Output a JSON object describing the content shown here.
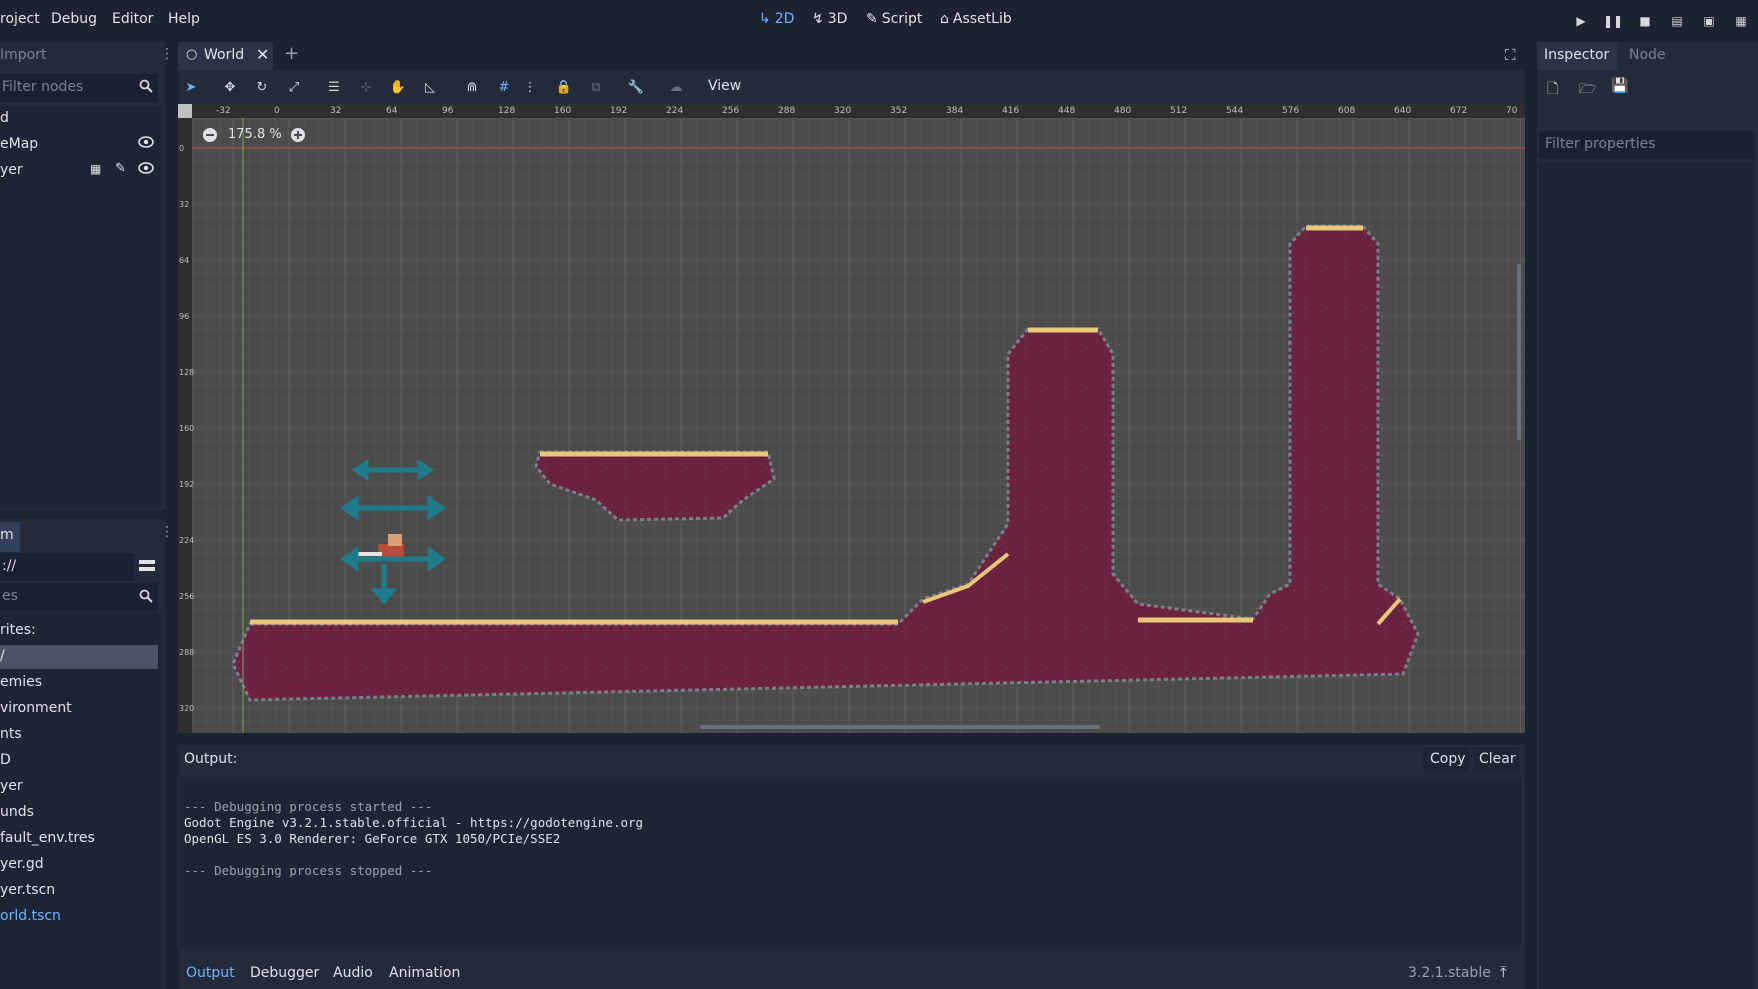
{
  "menu": {
    "project": "roject",
    "debug": "Debug",
    "editor": "Editor",
    "help": "Help"
  },
  "modes": {
    "m2d": "2D",
    "m3d": "3D",
    "script": "Script",
    "assetlib": "AssetLib"
  },
  "colors": {
    "accent": "#6fb3ff",
    "bg": "#1d2230",
    "panel": "#232a3a",
    "viewport": "#4b4b4b",
    "terrain": "#6b2340",
    "terrain_top": "#e8c67a"
  },
  "left_dock": {
    "import_tab": "Import",
    "filter_nodes_placeholder": "Filter nodes",
    "tree": [
      "d",
      "eMap",
      "yer"
    ],
    "fs_tab": "m",
    "path": "://",
    "search_placeholder": "es",
    "fs_items": [
      "rites:",
      "/",
      "emies",
      "vironment",
      "nts",
      "D",
      "yer",
      "unds",
      "fault_env.tres",
      "yer.gd",
      "yer.tscn",
      "orld.tscn"
    ]
  },
  "scene_tab": {
    "name": "World"
  },
  "toolbar": {
    "view_label": "View"
  },
  "viewport": {
    "zoom": "175.8 %",
    "ruler_x": [
      "-32",
      "0",
      "32",
      "64",
      "96",
      "128",
      "160",
      "192",
      "224",
      "256",
      "288",
      "320",
      "352",
      "384",
      "416",
      "448",
      "480",
      "512",
      "544",
      "576",
      "608",
      "640",
      "672",
      "70"
    ],
    "ruler_y": [
      "0",
      "32",
      "64",
      "96",
      "128",
      "160",
      "192",
      "224",
      "256",
      "288",
      "320"
    ]
  },
  "output": {
    "title": "Output:",
    "copy": "Copy",
    "clear": "Clear",
    "lines": [
      "--- Debugging process started ---",
      "Godot Engine v3.2.1.stable.official - https://godotengine.org",
      "OpenGL ES 3.0 Renderer: GeForce GTX 1050/PCIe/SSE2",
      "",
      "--- Debugging process stopped ---"
    ]
  },
  "bottom_tabs": {
    "output": "Output",
    "debugger": "Debugger",
    "audio": "Audio",
    "animation": "Animation",
    "version": "3.2.1.stable"
  },
  "inspector": {
    "tab_inspector": "Inspector",
    "tab_node": "Node",
    "filter_placeholder": "Filter properties"
  }
}
